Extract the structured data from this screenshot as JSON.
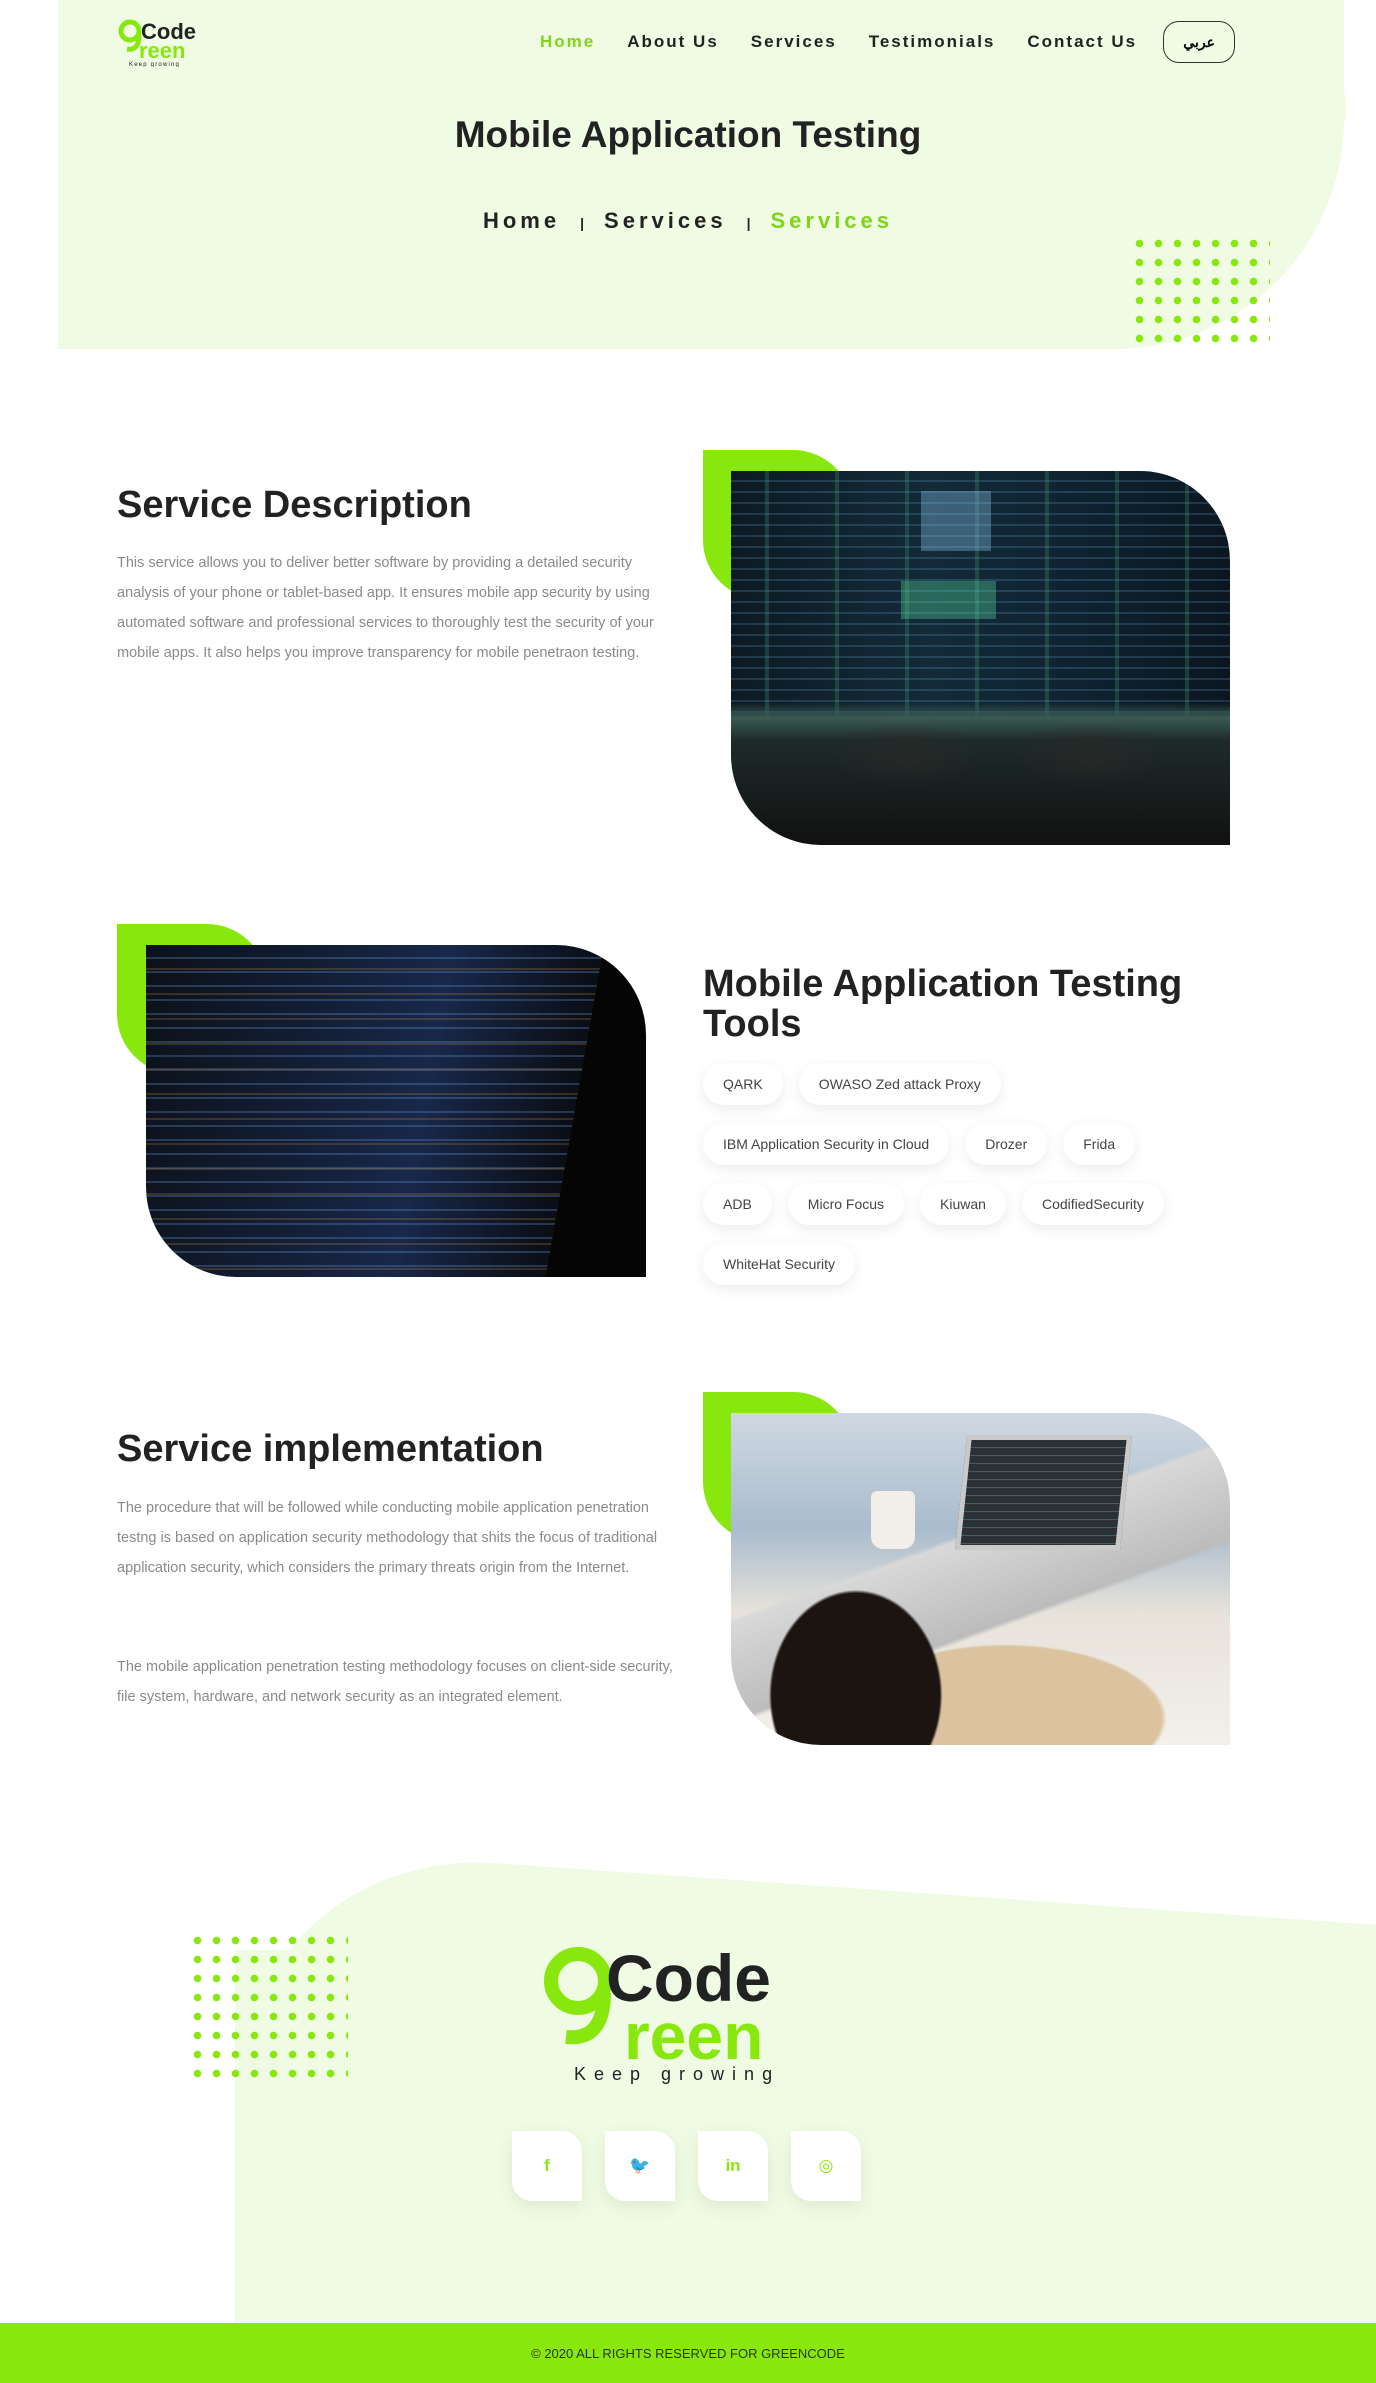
{
  "brand": {
    "logo_top": "Code",
    "logo_bottom": "reen",
    "tagline": "Keep growing",
    "accent": "#88e80d",
    "light_bg": "#effbe2"
  },
  "nav": {
    "items": [
      {
        "label": "Home",
        "active": true
      },
      {
        "label": "About Us"
      },
      {
        "label": "Services"
      },
      {
        "label": "Testimonials"
      },
      {
        "label": "Contact Us"
      }
    ],
    "lang_label": "عربي"
  },
  "hero": {
    "title": "Mobile Application Testing",
    "breadcrumb": [
      "Home",
      "Services",
      "Services"
    ],
    "separator": "|"
  },
  "description": {
    "title": "Service Description",
    "text": "This service allows you to deliver better software by providing a detailed security analysis of your phone or tablet-based app. It ensures mobile app security by using automated software and professional services to thoroughly test the security of your mobile apps. It also helps you improve transparency for mobile penetraon testing."
  },
  "tools": {
    "title": "Mobile Application Testing Tools",
    "items": [
      "QARK",
      "OWASO Zed attack Proxy",
      "IBM Application Security in Cloud",
      "Drozer",
      "Frida",
      "ADB",
      "Micro Focus",
      "Kiuwan",
      "CodifiedSecurity",
      "WhiteHat Security"
    ]
  },
  "implementation": {
    "title": "Service implementation",
    "paragraphs": [
      "The procedure that will be followed while conducting mobile application penetration testng is based on application security methodology that shits the focus of traditional application security, which considers the primary threats origin from the Internet.",
      "The mobile application penetration testing methodology focuses on client-side security, file system, hardware, and network security as an integrated element."
    ]
  },
  "footer": {
    "socials": [
      {
        "icon": "facebook-icon",
        "glyph": "f"
      },
      {
        "icon": "twitter-icon",
        "glyph": "🐦"
      },
      {
        "icon": "linkedin-icon",
        "glyph": "in"
      },
      {
        "icon": "instagram-icon",
        "glyph": "◎"
      }
    ],
    "copyright": "© 2020 ALL RIGHTS RESERVED FOR GREENCODE"
  }
}
